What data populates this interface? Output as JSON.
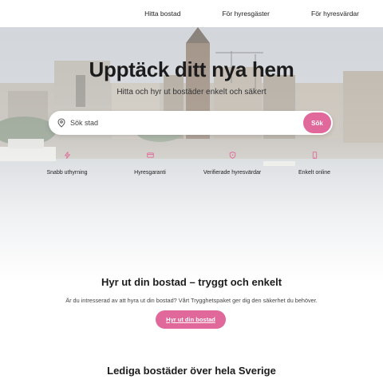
{
  "nav": {
    "items": [
      {
        "label": "Hitta bostad"
      },
      {
        "label": "För hyresgäster"
      },
      {
        "label": "För hyresvärdar"
      }
    ]
  },
  "hero": {
    "title": "Upptäck ditt nya hem",
    "subtitle": "Hitta och hyr ut bostäder enkelt och säkert",
    "search": {
      "placeholder": "Sök stad",
      "button_label": "Sök",
      "icon": "location-pin-icon"
    },
    "features": [
      {
        "label": "Snabb uthyrning",
        "icon": "zap-icon"
      },
      {
        "label": "Hyresgaranti",
        "icon": "credit-card-icon"
      },
      {
        "label": "Verifierade hyresvärdar",
        "icon": "shield-icon"
      },
      {
        "label": "Enkelt online",
        "icon": "smartphone-icon"
      }
    ]
  },
  "landlord_section": {
    "title": "Hyr ut din bostad – tryggt och enkelt",
    "text": "Är du intresserad av att hyra ut din bostad? Vårt Trygghetspaket ger dig den säkerhet du behöver.",
    "button_label": "Hyr ut din bostad"
  },
  "listings_section": {
    "title": "Lediga bostäder över hela Sverige"
  },
  "colors": {
    "accent": "#e0689a",
    "text": "#1c1c1c",
    "background": "#ffffff"
  }
}
